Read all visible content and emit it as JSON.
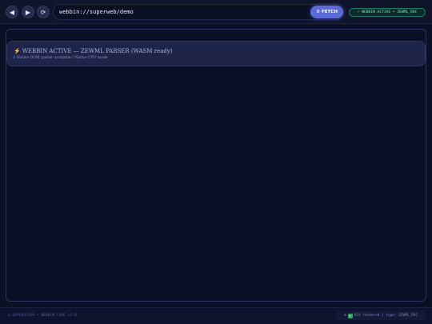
{
  "toolbar": {
    "back_icon": "◀",
    "forward_icon": "▶",
    "reload_icon": "⟳",
    "url": "webbin://superweb/demo",
    "fetch_label": "FETCH",
    "fetch_icon": "⚙",
    "status": "⚡ WEBBIN ACTIVE • ZEWML_DOC"
  },
  "main": {
    "ghost_line": "",
    "banner": {
      "icon": "⚡",
      "title": "WEBBIN ACTIVE — ZEWML PARSER (WASM ready)",
      "sub_icon": "ℹ",
      "subtitle": "Native DOM parser available / Native CPU mode"
    }
  },
  "footer": {
    "left": "⚙ SUPERVISOR • WEBBIN CORE v2.0",
    "right_gear": "⚙",
    "right_check": "✔",
    "right": "DIV rendered | type: ZEWML_DOC"
  },
  "colors": {
    "background": "#0b1024",
    "accent": "#5b6ad9",
    "status_green": "#6ff0c0",
    "bolt": "#ffd23f"
  }
}
